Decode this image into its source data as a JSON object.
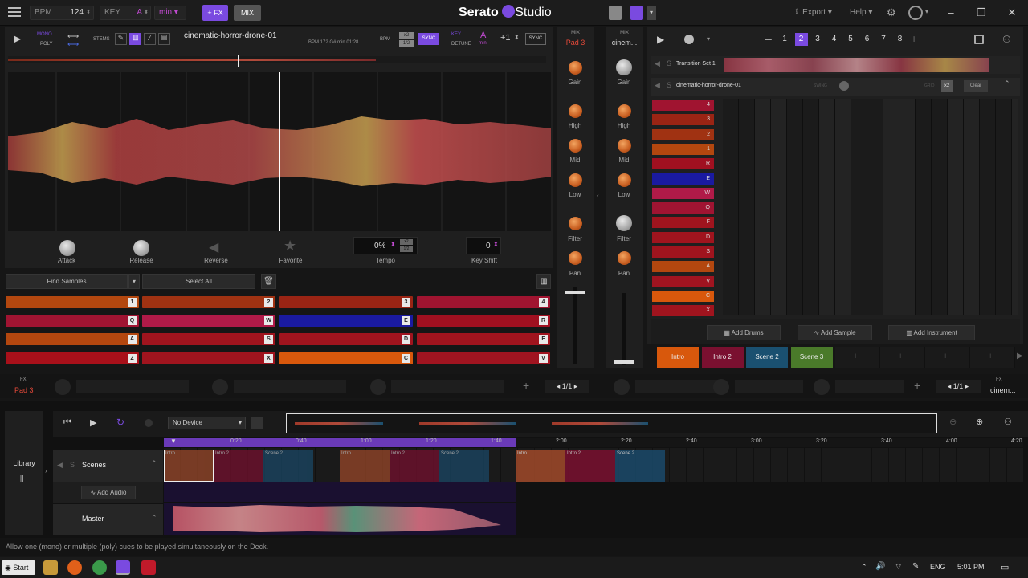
{
  "titlebar": {
    "bpm_label": "BPM",
    "bpm_value": "124",
    "key_label": "KEY",
    "key_value": "A",
    "key_mode": "min",
    "fx_button": "+ FX",
    "mix_button": "MIX",
    "app_name": "Serato",
    "app_name2": "Studio",
    "export": "Export",
    "help": "Help"
  },
  "deck": {
    "mono": "MONO",
    "poly": "POLY",
    "stems": "STEMS",
    "track_name": "cinematic-horror-drone-01",
    "track_info": "BPM 172  G# min  01:28",
    "bpm_label": "BPM",
    "ratio_top": "x2",
    "ratio_bottom": "1/2",
    "sync": "SYNC",
    "key_label": "KEY",
    "detune": "DETUNE",
    "key_value": "A",
    "key_mode": "min",
    "key_shift": "+1",
    "sync2": "SYNC",
    "attack": "Attack",
    "release": "Release",
    "reverse": "Reverse",
    "favorite": "Favorite",
    "tempo_value": "0%",
    "tempo_label": "Tempo",
    "keyshift_value": "0",
    "keyshift_label": "Key Shift",
    "find_samples": "Find Samples",
    "select_all": "Select All"
  },
  "pads": [
    {
      "key": "1",
      "color": "#b3470f"
    },
    {
      "key": "2",
      "color": "#a03212"
    },
    {
      "key": "3",
      "color": "#9a2414"
    },
    {
      "key": "4",
      "color": "#a01430"
    },
    {
      "key": "Q",
      "color": "#a01432"
    },
    {
      "key": "W",
      "color": "#b01a48"
    },
    {
      "key": "E",
      "color": "#1a1aa0"
    },
    {
      "key": "R",
      "color": "#a01020"
    },
    {
      "key": "A",
      "color": "#b3470f"
    },
    {
      "key": "S",
      "color": "#a0141e"
    },
    {
      "key": "D",
      "color": "#a0141e"
    },
    {
      "key": "F",
      "color": "#a0141e"
    },
    {
      "key": "Z",
      "color": "#a8101a"
    },
    {
      "key": "X",
      "color": "#a0141e"
    },
    {
      "key": "C",
      "color": "#d8580c"
    },
    {
      "key": "V",
      "color": "#a01420"
    }
  ],
  "mixer_left": {
    "title": "MIX",
    "pad": "Pad 3",
    "gain": "Gain",
    "high": "High",
    "mid": "Mid",
    "low": "Low",
    "filter": "Filter",
    "pan": "Pan"
  },
  "mixer_right": {
    "title": "MIX",
    "name": "cinem...",
    "gain": "Gain",
    "high": "High",
    "mid": "Mid",
    "low": "Low",
    "filter": "Filter",
    "pan": "Pan"
  },
  "sequencer": {
    "pages": [
      "1",
      "2",
      "3",
      "4",
      "5",
      "6",
      "7",
      "8"
    ],
    "track1": "Transition Set 1",
    "track2": "cinematic-horror-drone-01",
    "swing": "SWING",
    "grid": "GRID",
    "grid_value": "x2",
    "clear": "Clear",
    "add_drums": "Add Drums",
    "add_sample": "Add Sample",
    "add_instrument": "Add Instrument"
  },
  "cue_rows": [
    {
      "key": "4",
      "color": "#a01430"
    },
    {
      "key": "3",
      "color": "#9a2414"
    },
    {
      "key": "2",
      "color": "#a03212"
    },
    {
      "key": "1",
      "color": "#b3470f"
    },
    {
      "key": "R",
      "color": "#a01020"
    },
    {
      "key": "E",
      "color": "#1a1aa0"
    },
    {
      "key": "W",
      "color": "#b01a48"
    },
    {
      "key": "Q",
      "color": "#a01432"
    },
    {
      "key": "F",
      "color": "#a0141e"
    },
    {
      "key": "D",
      "color": "#a0141e"
    },
    {
      "key": "S",
      "color": "#a0141e"
    },
    {
      "key": "A",
      "color": "#b3470f"
    },
    {
      "key": "V",
      "color": "#a01420"
    },
    {
      "key": "C",
      "color": "#d8580c"
    },
    {
      "key": "X",
      "color": "#a0141e"
    }
  ],
  "scenes": [
    {
      "label": "Intro",
      "color": "#d8580c"
    },
    {
      "label": "Intro 2",
      "color": "#7a1030"
    },
    {
      "label": "Scene 2",
      "color": "#1a5070"
    },
    {
      "label": "Scene 3",
      "color": "#4a7a2a"
    }
  ],
  "fx_bar": {
    "fx": "FX",
    "pad": "Pad 3",
    "page": "1/1",
    "page2": "1/1",
    "fx_right": "FX",
    "right_name": "cinem..."
  },
  "arranger": {
    "library": "Library",
    "device": "No Device",
    "scenes": "Scenes",
    "add_audio": "Add Audio",
    "master": "Master",
    "times": [
      "0:20",
      "0:40",
      "1:00",
      "1:20",
      "1:40",
      "2:00",
      "2:20",
      "2:40",
      "3:00",
      "3:20",
      "3:40",
      "4:00",
      "4:20"
    ],
    "blocks": [
      "Intro",
      "Intro 2",
      "Scene 2",
      "Intro",
      "Intro 2",
      "Scene 2",
      "Intro",
      "Intro 2",
      "Scene 2"
    ]
  },
  "status": "Allow one (mono) or multiple (poly) cues to be played simultaneously on the Deck.",
  "taskbar": {
    "start": "Start",
    "lang": "ENG",
    "time": "5:01 PM"
  }
}
